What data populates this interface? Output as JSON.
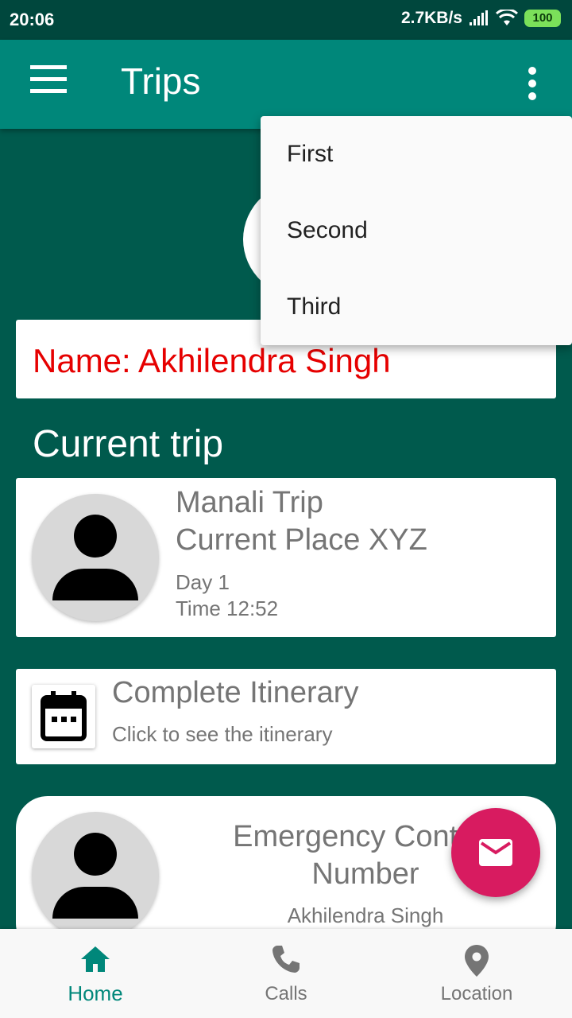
{
  "status_bar": {
    "time": "20:06",
    "network_speed": "2.7KB/s",
    "battery": "100"
  },
  "app_bar": {
    "title": "Trips"
  },
  "overflow_menu": {
    "items": [
      "First",
      "Second",
      "Third"
    ]
  },
  "profile": {
    "name_line": "Name: Akhilendra Singh"
  },
  "current_trip": {
    "section_title": "Current trip",
    "trip_name": "Manali Trip",
    "current_place": "Current Place XYZ",
    "day": "Day 1",
    "time": "Time 12:52"
  },
  "itinerary": {
    "title": "Complete Itinerary",
    "subtitle": "Click to see the itinerary"
  },
  "emergency": {
    "title": "Emergency Contact\nNumber",
    "contact_name": "Akhilendra Singh"
  },
  "bottom_nav": {
    "items": [
      {
        "label": "Home",
        "icon": "home-icon",
        "active": true
      },
      {
        "label": "Calls",
        "icon": "phone-icon",
        "active": false
      },
      {
        "label": "Location",
        "icon": "location-pin-icon",
        "active": false
      }
    ]
  },
  "colors": {
    "primary": "#00877a",
    "background": "#005a4d",
    "accent": "#d81b60",
    "name_text": "#e60000"
  }
}
